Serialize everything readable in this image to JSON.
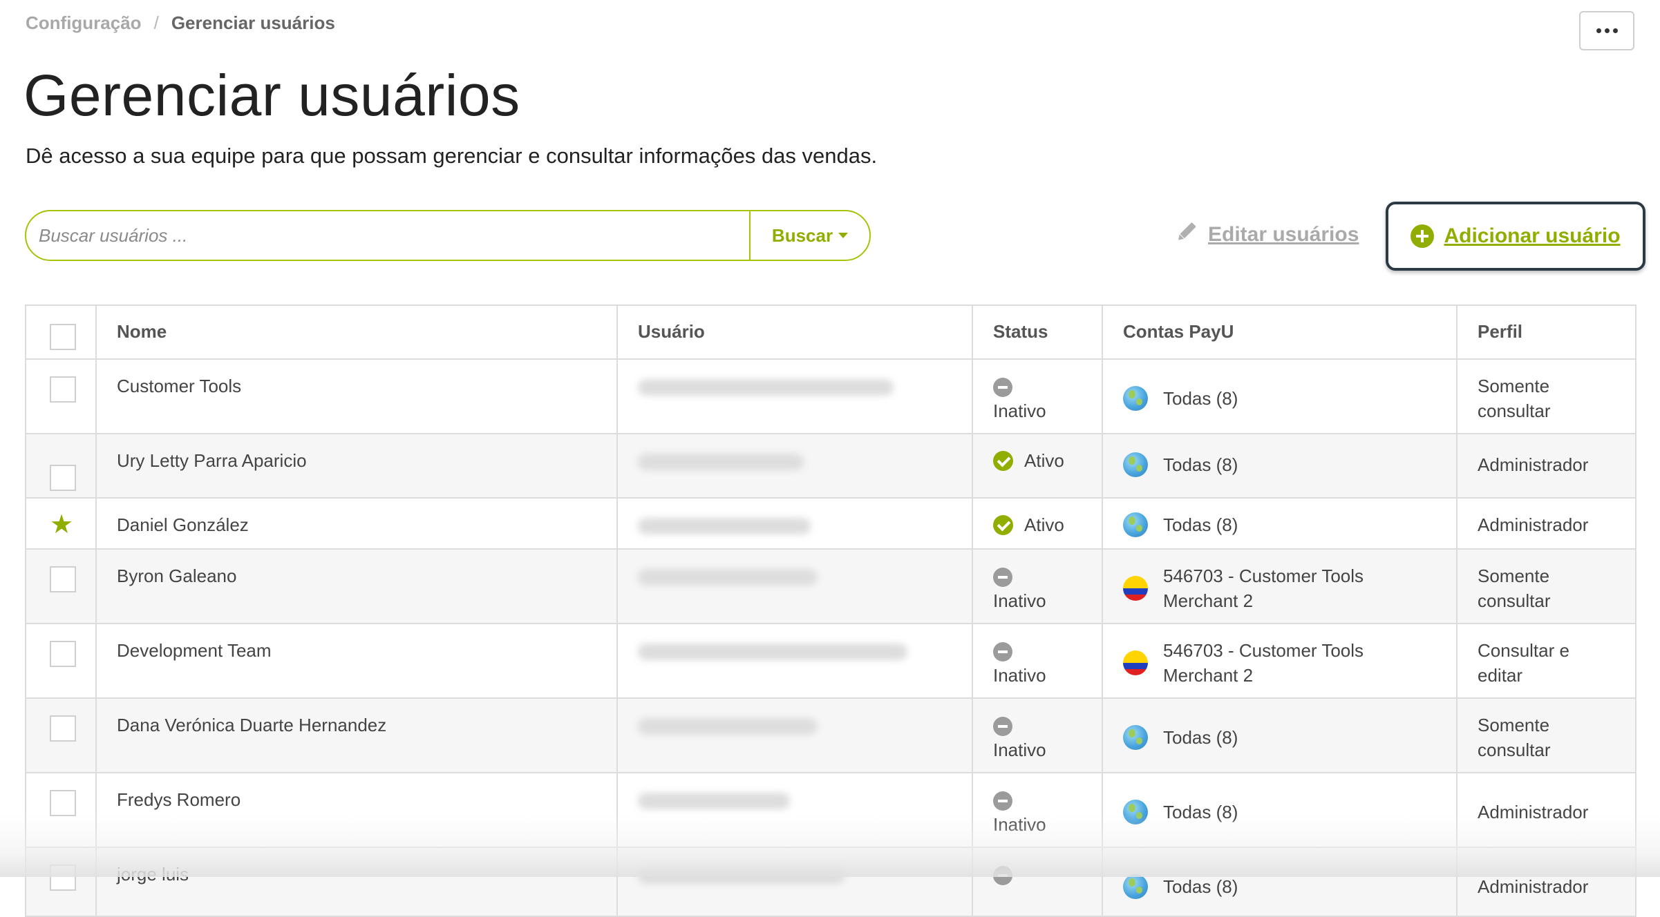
{
  "breadcrumb": {
    "parent": "Configuração",
    "separator": "/",
    "current": "Gerenciar usuários"
  },
  "header": {
    "title": "Gerenciar usuários",
    "description": "Dê acesso a sua equipe para que possam gerenciar e consultar informações das vendas.",
    "more_icon": "ellipsis-icon"
  },
  "search": {
    "placeholder": "Buscar usuários ...",
    "value": "",
    "button_label": "Buscar"
  },
  "actions": {
    "edit_label": "Editar usuários",
    "edit_icon": "pencil-icon",
    "add_label": "Adicionar usuário",
    "add_icon": "plus-circle-icon"
  },
  "table": {
    "columns": [
      "Nome",
      "Usuário",
      "Status",
      "Contas PayU",
      "Perfil"
    ],
    "rows": [
      {
        "name": "Customer Tools",
        "status": "Inativo",
        "account": "Todas (8)",
        "account_icon": "globe-icon",
        "profile": "Somente consultar",
        "marker": "checkbox"
      },
      {
        "name": "Ury Letty Parra Aparicio",
        "status": "Ativo",
        "account": "Todas (8)",
        "account_icon": "globe-icon",
        "profile": "Administrador",
        "marker": "checkbox"
      },
      {
        "name": "Daniel González",
        "status": "Ativo",
        "account": "Todas (8)",
        "account_icon": "globe-icon",
        "profile": "Administrador",
        "marker": "star"
      },
      {
        "name": "Byron Galeano",
        "status": "Inativo",
        "account": "546703 - Customer Tools Merchant 2",
        "account_icon": "colombia-flag-icon",
        "profile": "Somente consultar",
        "marker": "checkbox"
      },
      {
        "name": "Development Team",
        "status": "Inativo",
        "account": "546703 - Customer Tools Merchant 2",
        "account_icon": "colombia-flag-icon",
        "profile": "Consultar e editar",
        "marker": "checkbox"
      },
      {
        "name": "Dana Verónica Duarte Hernandez",
        "status": "Inativo",
        "account": "Todas (8)",
        "account_icon": "globe-icon",
        "profile": "Somente consultar",
        "marker": "checkbox"
      },
      {
        "name": "Fredys Romero",
        "status": "Inativo",
        "account": "Todas (8)",
        "account_icon": "globe-icon",
        "profile": "Administrador",
        "marker": "checkbox"
      },
      {
        "name": "jorge luis",
        "status": "",
        "account": "Todas (8)",
        "account_icon": "globe-icon",
        "profile": "Administrador",
        "marker": "checkbox"
      }
    ]
  },
  "colors": {
    "accent": "#8fae00",
    "search_border": "#a6c307",
    "add_button_border": "#2c3a45",
    "inactive_icon": "#9b9b9b"
  }
}
